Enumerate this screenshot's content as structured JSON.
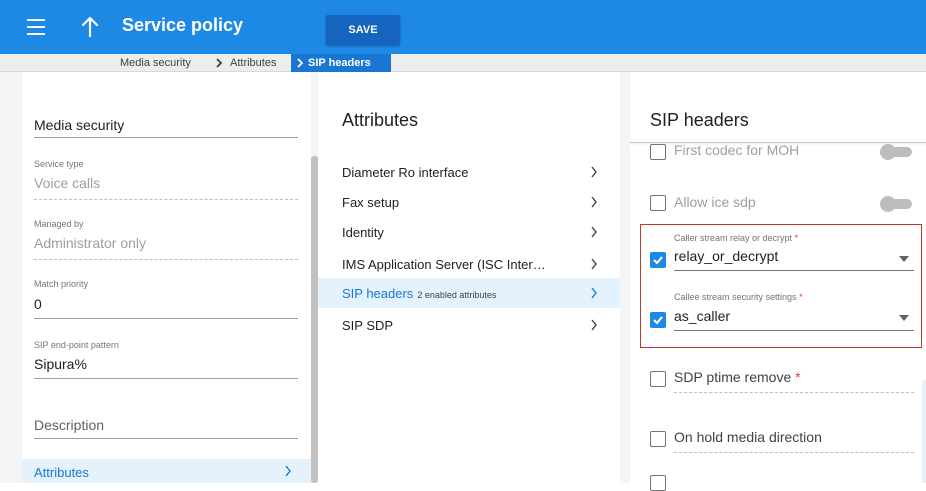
{
  "header": {
    "title": "Service policy",
    "save_label": "SAVE",
    "menu_icon": "hamburger-icon",
    "up_icon": "arrow-up-icon",
    "color": "#1e88e5"
  },
  "breadcrumb": {
    "items": [
      "Media security",
      "Attributes"
    ],
    "current": "SIP headers"
  },
  "form": {
    "name_value": "Media security",
    "service_type_label": "Service type",
    "service_type_value": "Voice calls",
    "managed_by_label": "Managed by",
    "managed_by_value": "Administrator only",
    "match_priority_label": "Match priority",
    "match_priority_value": "0",
    "sip_pattern_label": "SIP end-point pattern",
    "sip_pattern_value": "Sipura%",
    "description_placeholder": "Description",
    "attributes_label": "Attributes"
  },
  "attributes": {
    "title": "Attributes",
    "items": [
      {
        "label": "Diameter Ro interface",
        "sub": ""
      },
      {
        "label": "Fax setup",
        "sub": ""
      },
      {
        "label": "Identity",
        "sub": ""
      },
      {
        "label": "IMS Application Server (ISC Inter…",
        "sub": ""
      },
      {
        "label": "SIP headers",
        "sub": "2 enabled attributes",
        "active": true
      },
      {
        "label": "SIP SDP",
        "sub": ""
      }
    ]
  },
  "sip_headers": {
    "title": "SIP headers",
    "first_codec_label": "First codec for MOH",
    "allow_ice_label": "Allow ice sdp",
    "caller_label": "Caller stream relay or decrypt",
    "caller_value": "relay_or_decrypt",
    "callee_label": "Callee stream security settings",
    "callee_value": "as_caller",
    "ptime_label": "SDP ptime remove",
    "on_hold_label": "On hold media direction",
    "required_mark": "*",
    "accent": "#1e88e5",
    "highlight": "#c0392b"
  }
}
